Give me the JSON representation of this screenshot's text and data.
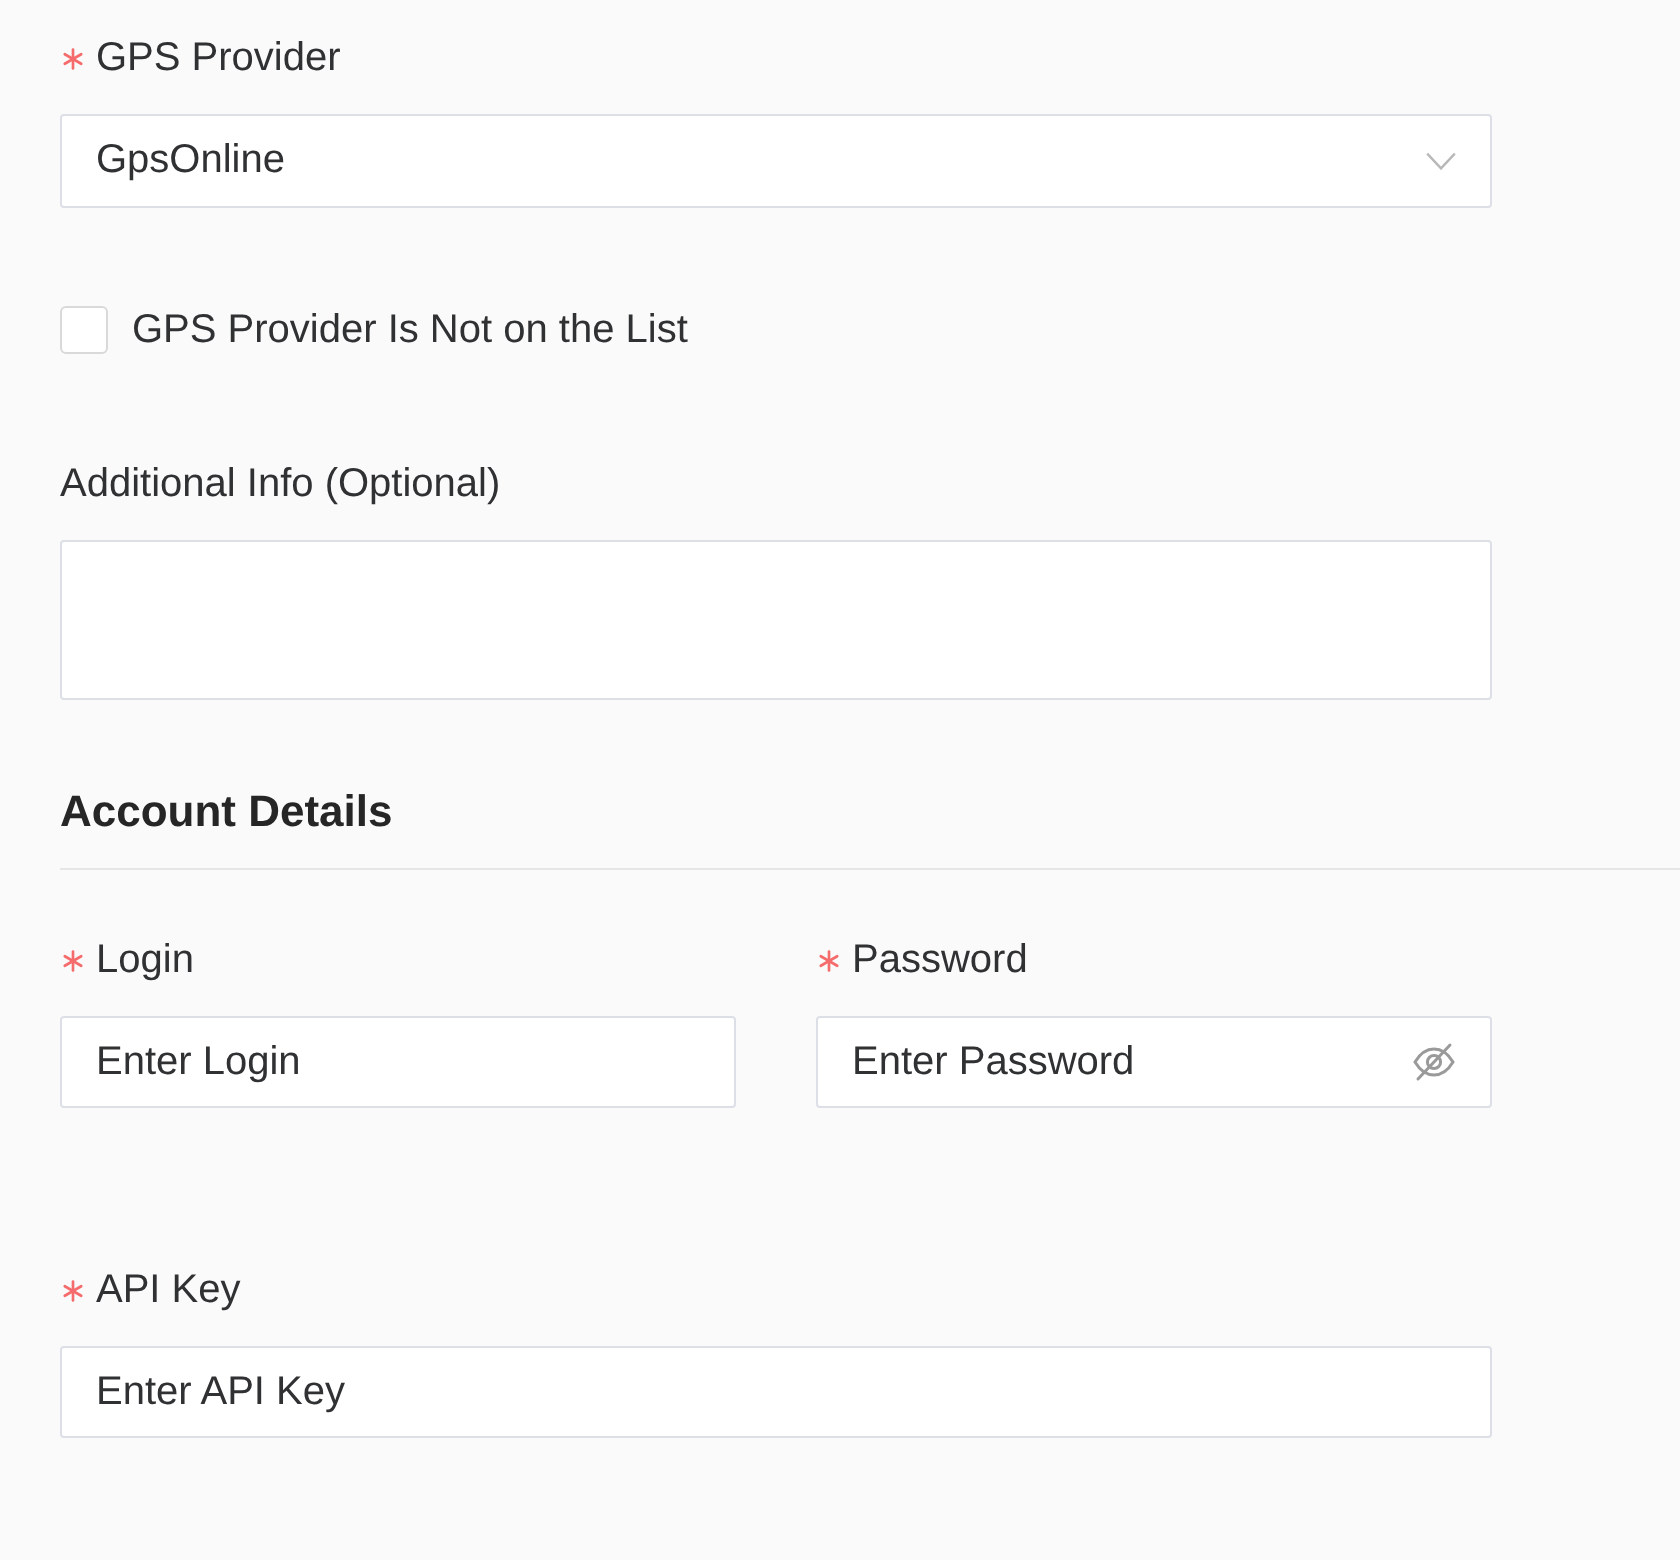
{
  "provider": {
    "label": "GPS Provider",
    "required": true,
    "value": "GpsOnline"
  },
  "not_listed": {
    "label": "GPS Provider Is Not on the List",
    "checked": false
  },
  "additional_info": {
    "label": "Additional Info (Optional)",
    "required": false
  },
  "account_details": {
    "title": "Account Details",
    "rows": [
      {
        "fields": [
          {
            "kind": "text",
            "label": "Login",
            "required": true,
            "placeholder": "Enter Login"
          },
          {
            "kind": "password",
            "label": "Password",
            "required": true,
            "placeholder": "Enter Password"
          }
        ]
      },
      {
        "fields": [
          {
            "kind": "text",
            "label": "API Key",
            "required": true,
            "placeholder": "Enter API Key"
          }
        ]
      }
    ]
  }
}
